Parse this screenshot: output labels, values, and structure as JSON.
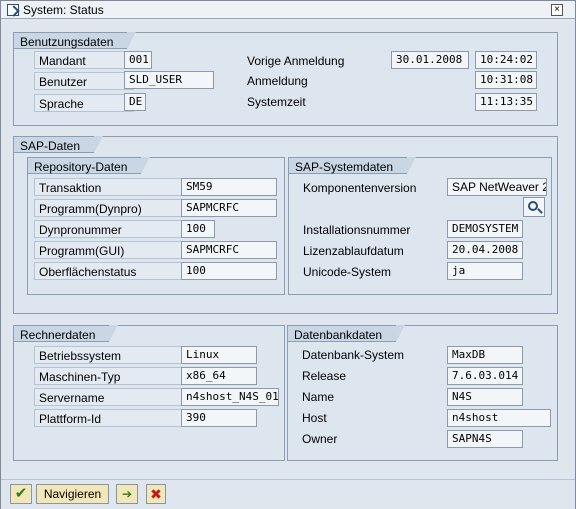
{
  "window": {
    "title": "System: Status"
  },
  "usage": {
    "title": "Benutzungsdaten",
    "client_label": "Mandant",
    "client_value": "001",
    "user_label": "Benutzer",
    "user_value": "SLD_USER",
    "language_label": "Sprache",
    "language_value": "DE",
    "prev_login_label": "Vorige Anmeldung",
    "prev_login_date": "30.01.2008",
    "prev_login_time": "10:24:02",
    "login_label": "Anmeldung",
    "login_time": "10:31:08",
    "system_time_label": "Systemzeit",
    "system_time": "11:13:35"
  },
  "sap": {
    "title": "SAP-Daten",
    "repository": {
      "title": "Repository-Daten",
      "transaction_label": "Transaktion",
      "transaction_value": "SM59",
      "program_dynpro_label": "Programm(Dynpro)",
      "program_dynpro_value": "SAPMCRFC",
      "dynpro_number_label": "Dynpronummer",
      "dynpro_number_value": "100",
      "program_gui_label": "Programm(GUI)",
      "program_gui_value": "SAPMCRFC",
      "gui_status_label": "Oberflächenstatus",
      "gui_status_value": "100"
    },
    "system": {
      "title": "SAP-Systemdaten",
      "component_version_label": "Komponentenversion",
      "component_version_value": "SAP NetWeaver 2",
      "installation_number_label": "Installationsnummer",
      "installation_number_value": "DEMOSYSTEM",
      "license_expiry_label": "Lizenzablaufdatum",
      "license_expiry_value": "20.04.2008",
      "unicode_label": "Unicode-System",
      "unicode_value": "ja"
    }
  },
  "host": {
    "title": "Rechnerdaten",
    "os_label": "Betriebssystem",
    "os_value": "Linux",
    "machine_type_label": "Maschinen-Typ",
    "machine_type_value": "x86_64",
    "server_label": "Servername",
    "server_value": "n4shost_N4S_01",
    "platform_label": "Plattform-Id",
    "platform_value": "390"
  },
  "database": {
    "title": "Datenbankdaten",
    "db_system_label": "Datenbank-System",
    "db_system_value": "MaxDB",
    "release_label": "Release",
    "release_value": "7.6.03.014",
    "name_label": "Name",
    "name_value": "N4S",
    "host_label": "Host",
    "host_value": "n4shost",
    "owner_label": "Owner",
    "owner_value": "SAPN4S"
  },
  "toolbar": {
    "navigate_label": "Navigieren"
  }
}
